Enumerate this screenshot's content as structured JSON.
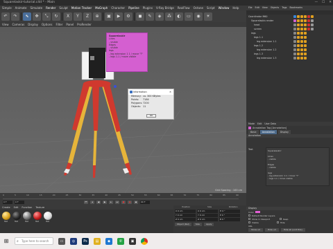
{
  "window": {
    "title": "Squarelaskir-tutorial.c4d * - Main"
  },
  "menubar": [
    "Simple",
    "Animate",
    "Simulate",
    "Render",
    "Sculpt",
    "Motion Tracker",
    "MoGraph",
    "Character",
    "Pipeline",
    "Plugins",
    "V-Ray Bridge",
    "RealFlow",
    "Octane",
    "Script",
    "Window",
    "Help"
  ],
  "viewport": {
    "menu": [
      "View",
      "Cameras",
      "Display",
      "Options",
      "Filter",
      "Panel",
      "ProRender"
    ],
    "grid_spacing": "Grid Spacing : 100 cm"
  },
  "annotation": {
    "title": "Squarelaskir",
    "lines": [
      "Lines",
      "- visible",
      "Edges",
      "- visible",
      "legs",
      "- leg extension 1 1 / move \"?\"",
      "- legs 1.1 / move visible"
    ]
  },
  "dialog": {
    "title": "Information",
    "rows": [
      {
        "k": "Memory:",
        "v": "ca. 300 KBytes"
      },
      {
        "k": "Points:",
        "v": "7184"
      },
      {
        "k": "Polygons:",
        "v": "7200"
      },
      {
        "k": "Objects:",
        "v": "11"
      }
    ],
    "ok": "OK"
  },
  "timeline": {
    "ticks": [
      "0",
      "5",
      "10",
      "15",
      "20",
      "25",
      "30",
      "35",
      "40",
      "45",
      "50",
      "55",
      "60",
      "65",
      "70",
      "75",
      "80",
      "85",
      "90"
    ],
    "start": "0 F",
    "current": "0 F",
    "end": "90 F"
  },
  "materials": {
    "menu": [
      "Create",
      "Edit",
      "Function",
      "Texture"
    ],
    "items": [
      {
        "name": "Mat",
        "color": "#d9a21e"
      },
      {
        "name": "Mat",
        "color": "#2a2a2a"
      },
      {
        "name": "Mat",
        "color": "#777777"
      },
      {
        "name": "Mat",
        "color": "#c91e1e"
      },
      {
        "name": "Mat",
        "color": "#dddddd"
      }
    ]
  },
  "coordinates": {
    "heads": [
      "Position",
      "Size",
      "Rotation"
    ],
    "rows": [
      {
        "p": "X  0 cm",
        "s": "X  0 cm",
        "r": "H  0 °"
      },
      {
        "p": "Y  0 cm",
        "s": "Y  0 cm",
        "r": "P  0 °"
      },
      {
        "p": "Z  0 cm",
        "s": "Z  0 cm",
        "r": "B  0 °"
      }
    ],
    "mode1": "Object (Rel)",
    "mode2": "Size",
    "apply": "Apply"
  },
  "object_manager": {
    "menu": [
      "File",
      "Edit",
      "View",
      "Objects",
      "Tags",
      "Bookmarks"
    ],
    "rows": [
      {
        "name": "Coordinator M60",
        "indent": 0,
        "tags": [
          "#3a86d9",
          "#e0a020",
          "#e0a020",
          "#e0a020",
          "#d03030",
          "#e0a020"
        ]
      },
      {
        "name": "Squarelaskir-render",
        "indent": 1,
        "tags": [
          "#d45fd0",
          "#e0a020",
          "#e0a020",
          "#e0a020",
          "#d03030",
          "#999"
        ]
      },
      {
        "name": "head",
        "indent": 2,
        "tags": [
          "#888",
          "#e0a020",
          "#e0a020",
          "#e0a020",
          "#d03030",
          "#999"
        ]
      },
      {
        "name": "screen",
        "indent": 2,
        "tags": [
          "#888",
          "#e0a020",
          "#e0a020",
          "#e0a020",
          "#d03030",
          "#999"
        ]
      },
      {
        "name": "legs",
        "indent": 1,
        "tags": [
          "#888",
          "#e0a020",
          "#e0a020",
          "#e0a020"
        ]
      },
      {
        "name": "legs 1.1",
        "indent": 2,
        "tags": [
          "#888",
          "#e0a020",
          "#e0a020",
          "#e0a020"
        ]
      },
      {
        "name": "leg extension 1.1",
        "indent": 3,
        "tags": [
          "#888",
          "#e0a020",
          "#e0a020",
          "#e0a020"
        ]
      },
      {
        "name": "legs 1.2",
        "indent": 2,
        "tags": [
          "#888",
          "#e0a020",
          "#e0a020",
          "#e0a020"
        ]
      },
      {
        "name": "leg extension 1.2",
        "indent": 3,
        "tags": [
          "#888",
          "#e0a020",
          "#e0a020",
          "#e0a020"
        ]
      },
      {
        "name": "legs 1.3",
        "indent": 2,
        "tags": [
          "#888",
          "#e0a020",
          "#e0a020",
          "#e0a020"
        ]
      },
      {
        "name": "leg extension 1.3",
        "indent": 3,
        "tags": [
          "#888",
          "#e0a020",
          "#e0a020",
          "#e0a020"
        ]
      }
    ]
  },
  "attribute_manager": {
    "menu": [
      "Mode",
      "Edit",
      "User Data"
    ],
    "title": "Annotation Tag [Annotation]",
    "tabs": [
      "Basic",
      "Annotation",
      "Display"
    ],
    "section": "Annotation",
    "text_label": "Text",
    "text": "Squarelaskirr\n\nLines\n- visible\n\nEdges\n- visible\n\nlegs\n- leg extension 1.1 / move \"?\"\n- legs 1.1 / move visible",
    "display_section": "Display",
    "color_label": "Color",
    "use_color": "Default Render Layers",
    "show_in_viewport": "Show in Viewport",
    "keep": "Keep",
    "visible": "Visible",
    "hide": "Hide",
    "url": "URL",
    "btn1": "Show url",
    "btn2": "Hide url",
    "btn3": "Hide all (unit this)"
  },
  "taskbar": {
    "search_placeholder": "Type here to search"
  }
}
